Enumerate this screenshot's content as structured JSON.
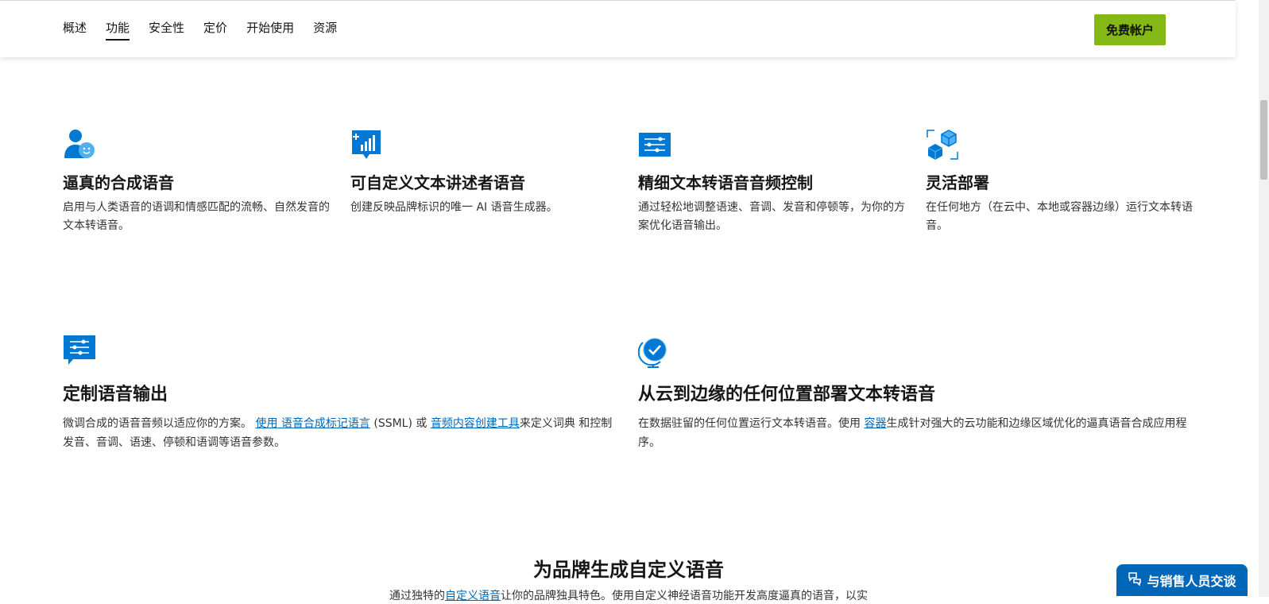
{
  "nav": {
    "items": [
      {
        "label": "概述"
      },
      {
        "label": "功能"
      },
      {
        "label": "安全性"
      },
      {
        "label": "定价"
      },
      {
        "label": "开始使用"
      },
      {
        "label": "资源"
      }
    ],
    "active_index": 1,
    "cta_label": "免费帐户"
  },
  "features_row1": [
    {
      "icon": "person-smile-icon",
      "title": "逼真的合成语音",
      "desc": "启用与人类语音的语调和情感匹配的流畅、自然发音的文本转语音。"
    },
    {
      "icon": "chart-bubble-icon",
      "title": "可自定义文本讲述者语音",
      "desc": "创建反映品牌标识的唯一 AI 语音生成器。"
    },
    {
      "icon": "sliders-icon",
      "title": "精细文本转语音音频控制",
      "desc": "通过轻松地调整语速、音调、发音和停顿等，为你的方案优化语音输出。"
    },
    {
      "icon": "cubes-icon",
      "title": "灵活部署",
      "desc": "在任何地方（在云中、本地或容器边缘）运行文本转语音。"
    }
  ],
  "features_row2": [
    {
      "icon": "sliders-chat-icon",
      "title": "定制语音输出",
      "desc_part1": "微调合成的语音音频以适应你的方案。 ",
      "link1": "使用 语音合成标记语言",
      "desc_part2": " (SSML) 或 ",
      "link2": "音频内容创建工具",
      "desc_part3": "来定义词典 和控制发音、音调、语速、停顿和语调等语音参数。"
    },
    {
      "icon": "globe-check-icon",
      "title": "从云到边缘的任何位置部署文本转语音",
      "desc_part1": "在数据驻留的任何位置运行文本转语音。使用 ",
      "link1": "容器",
      "desc_part2": "生成针对强大的云功能和边缘区域优化的逼真语音合成应用程序。"
    }
  ],
  "section": {
    "title": "为品牌生成自定义语音",
    "sub_part1": "通过独特的",
    "sub_link": "自定义语音",
    "sub_part2": "让你的品牌独具特色。使用自定义神经语音功能开发高度逼真的语音，以实"
  },
  "chat": {
    "label": "与销售人员交谈",
    "icon": "chat-bubbles-icon"
  },
  "colors": {
    "accent_green": "#84b817",
    "link_blue": "#0067b8",
    "icon_blue": "#0078d4"
  }
}
